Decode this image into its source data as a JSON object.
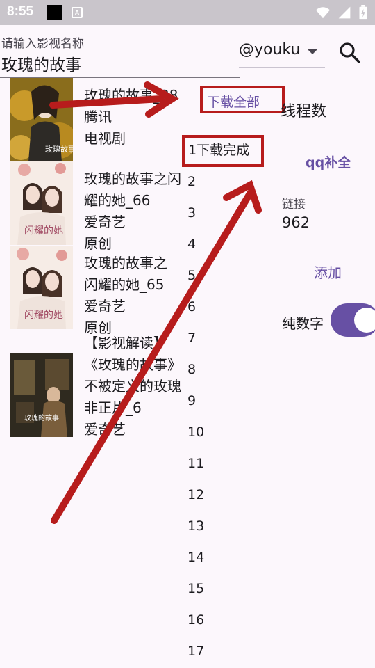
{
  "status": {
    "time": "8:55",
    "notif_icon_letter": "A"
  },
  "search": {
    "label": "请输入影视名称",
    "value": "玫瑰的故事"
  },
  "source": {
    "value": "@youku"
  },
  "results": [
    {
      "lines": [
        "玫瑰的故事_38",
        "腾讯",
        "电视剧"
      ],
      "poster_text": "玫瑰故事"
    },
    {
      "lines": [
        "玫瑰的故事之闪",
        "耀的她_66",
        "爱奇艺",
        "原创"
      ],
      "poster_text": "闪耀的她"
    },
    {
      "lines": [
        "玫瑰的故事之",
        "闪耀的她_65",
        "爱奇艺",
        "原创"
      ],
      "poster_text": "闪耀的她"
    },
    {
      "lines": [
        "【影视解读】",
        "《玫瑰的故事》",
        "不被定义的玫瑰",
        "非正片_6",
        "爱奇艺"
      ],
      "poster_text": "玫瑰的故事"
    }
  ],
  "episodes": [
    "2",
    "3",
    "4",
    "5",
    "6",
    "7",
    "8",
    "9",
    "10",
    "11",
    "12",
    "13",
    "14",
    "15",
    "16",
    "17"
  ],
  "download": {
    "all_label": "下载全部",
    "done_label": "1下载完成"
  },
  "panel": {
    "thread_label": "线程数",
    "qq_label": "qq补全",
    "link_label": "链接",
    "link_value": "962",
    "add_label": "添加",
    "pure_digits_label": "纯数字",
    "pure_digits_on": true
  },
  "colors": {
    "accent": "#6750a4",
    "annotation": "#b71c1c",
    "status_bar": "#c9c5cb"
  }
}
